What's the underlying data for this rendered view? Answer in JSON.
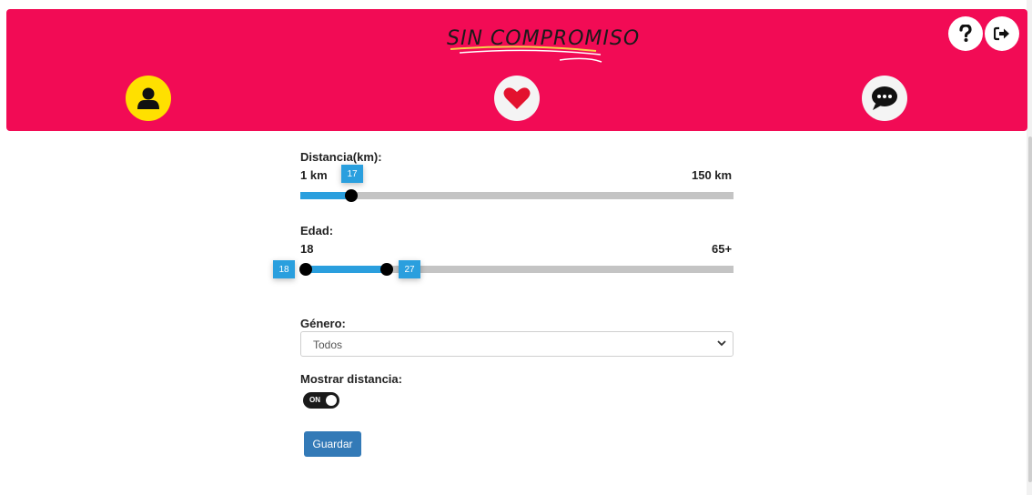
{
  "header": {
    "logo_text": "SIN COMPROMISO",
    "accent": "#f20b55",
    "nav": [
      {
        "name": "profile",
        "icon": "user-icon"
      },
      {
        "name": "likes",
        "icon": "heart-icon"
      },
      {
        "name": "chat",
        "icon": "chat-bubble-icon"
      }
    ],
    "help_icon": "question-icon",
    "logout_icon": "sign-out-icon"
  },
  "distance": {
    "label": "Distancia(km):",
    "min_label": "1 km",
    "max_label": "150 km",
    "value": "17",
    "min": 1,
    "max": 150
  },
  "age": {
    "label": "Edad:",
    "min_label": "18",
    "max_label": "65+",
    "low": "18",
    "high": "27"
  },
  "gender": {
    "label": "Género:",
    "selected": "Todos"
  },
  "show_distance": {
    "label": "Mostrar distancia:",
    "toggle_text": "ON",
    "on": true
  },
  "save_label": "Guardar"
}
